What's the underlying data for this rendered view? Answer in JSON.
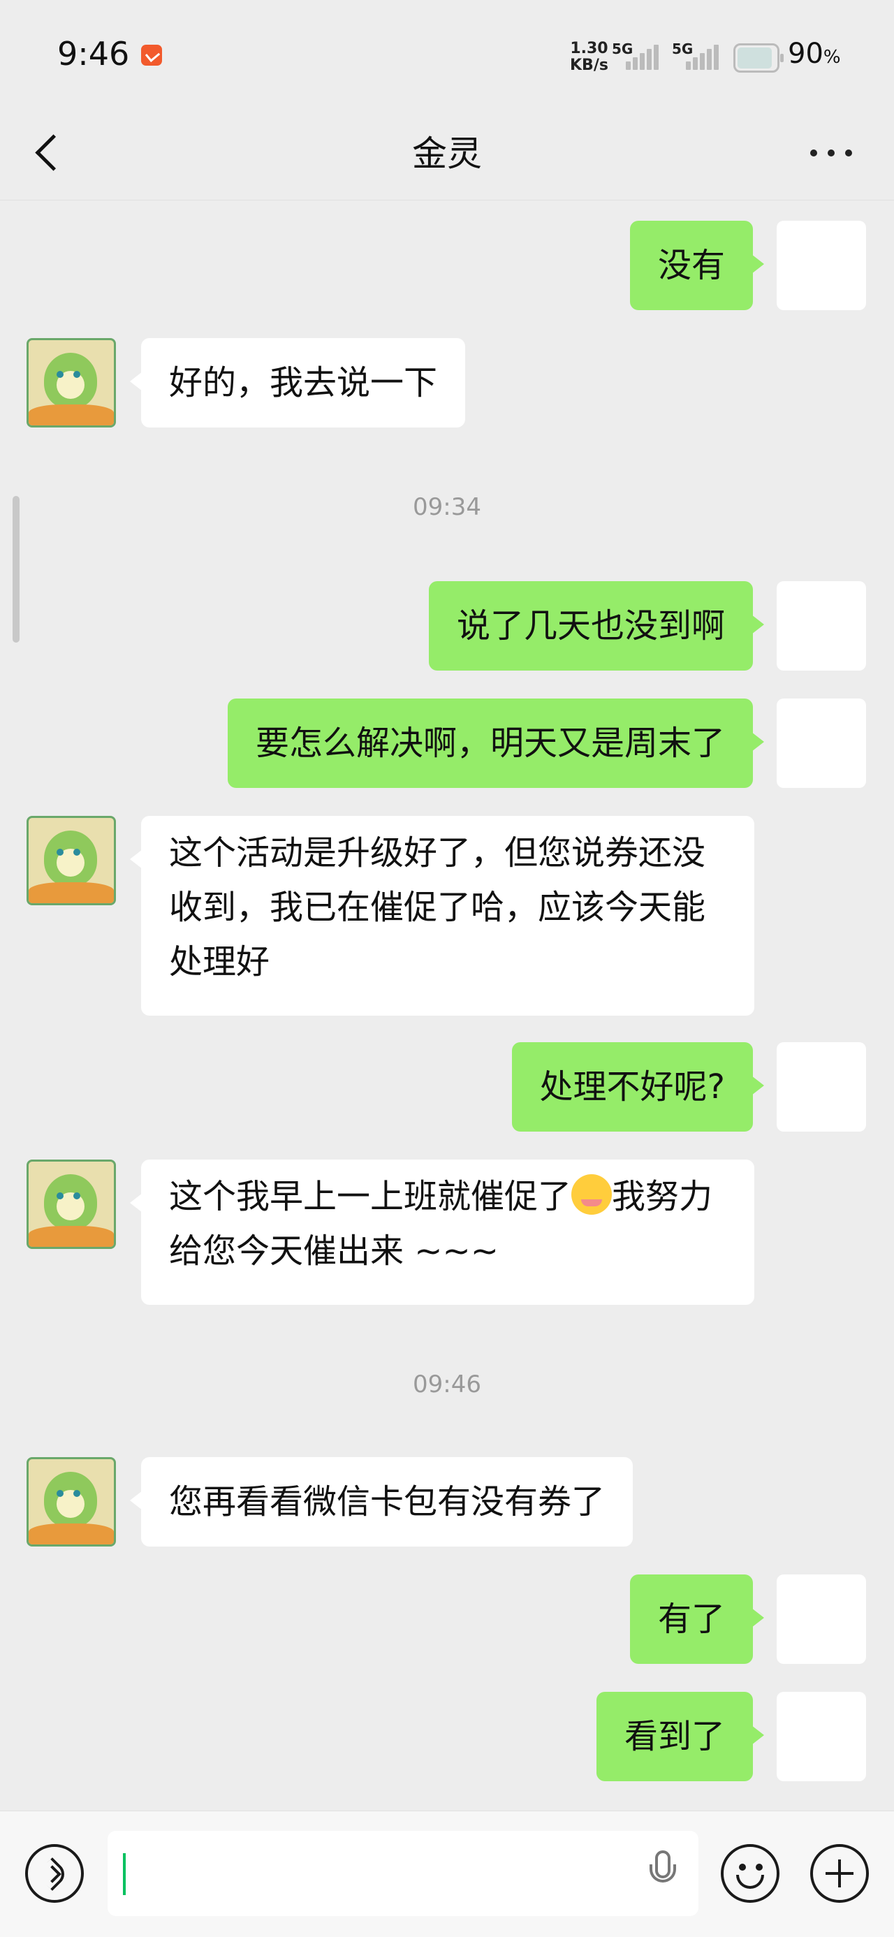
{
  "status_bar": {
    "time": "9:46",
    "net_speed_value": "1.30",
    "net_speed_unit": "KB/s",
    "network1": "5G",
    "network2": "5G",
    "battery": "90",
    "battery_unit": "%"
  },
  "header": {
    "title": "金灵"
  },
  "messages": [
    {
      "side": "me",
      "text": "没有"
    },
    {
      "side": "them",
      "text": "好的，我去说一下"
    },
    {
      "type": "time",
      "text": "09:34"
    },
    {
      "side": "me",
      "text": "说了几天也没到啊"
    },
    {
      "side": "me",
      "text": "要怎么解决啊，明天又是周末了"
    },
    {
      "side": "them",
      "text": "这个活动是升级好了，但您说券还没收到，我已在催促了哈，应该今天能处理好"
    },
    {
      "side": "me",
      "text": "处理不好呢?"
    },
    {
      "side": "them",
      "text_before_emoji": "这个我早上一上班就催促了",
      "emoji": "smiling-face",
      "text_after_emoji": "我努力给您今天催出来 ~~~"
    },
    {
      "type": "time",
      "text": "09:46"
    },
    {
      "side": "them",
      "text": "您再看看微信卡包有没有券了"
    },
    {
      "side": "me",
      "text": "有了"
    },
    {
      "side": "me",
      "text": "看到了"
    }
  ],
  "input_bar": {
    "text": ""
  },
  "colors": {
    "my_bubble": "#95ec69",
    "their_bubble": "#ffffff",
    "background": "#ededed",
    "cursor": "#07c160"
  }
}
